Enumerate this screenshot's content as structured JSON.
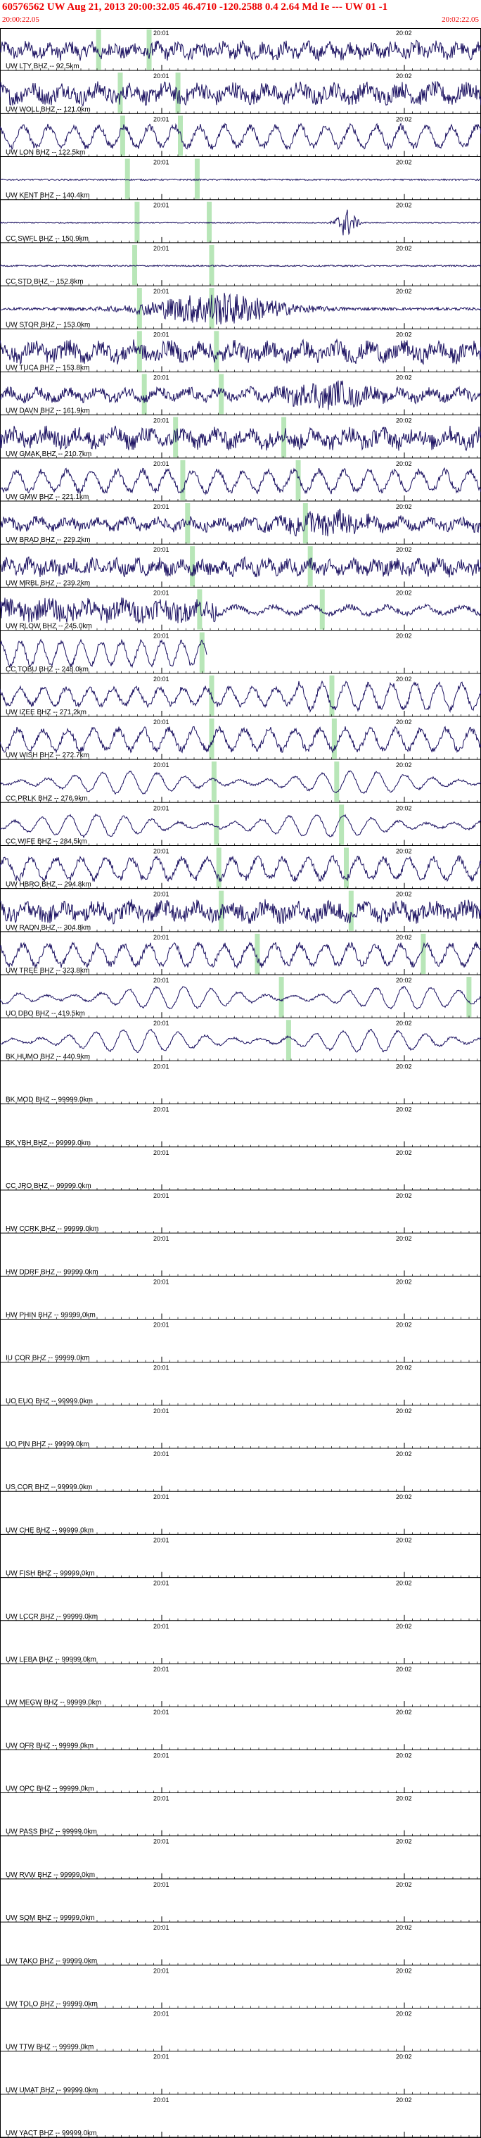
{
  "header": {
    "title": "60576562 UW Aug 21, 2013 20:00:32.05   46.4710 -120.2588  0.4 2.64 Md Ie --- UW 01   -1",
    "time_start": "20:00:22.05",
    "time_end": "20:02:22.05"
  },
  "minute_labels": [
    "20:01",
    "20:02"
  ],
  "colors": {
    "trace": "#1a1060",
    "axis": "#000000",
    "pick": "#b8e6b8",
    "header_text": "#ee0000"
  },
  "traces": [
    {
      "label": "UW LTY BHZ -- 92.5km",
      "waveform": "noisy-high",
      "picks": [
        0.205,
        0.31
      ]
    },
    {
      "label": "UW WOLL BHZ -- 121.0km",
      "waveform": "noisy-dense",
      "picks": [
        0.25,
        0.37
      ]
    },
    {
      "label": "UW LON BHZ -- 122.5km",
      "waveform": "oscillating",
      "picks": [
        0.255,
        0.375
      ]
    },
    {
      "label": "UW KENT BHZ -- 140.4km",
      "waveform": "flat",
      "picks": [
        0.265,
        0.41
      ]
    },
    {
      "label": "CC SWFL BHZ -- 150.9km",
      "waveform": "quiet-burst-right",
      "picks": [
        0.285,
        0.435
      ]
    },
    {
      "label": "CC STD BHZ -- 152.8km",
      "waveform": "flat",
      "picks": [
        0.28,
        0.44
      ]
    },
    {
      "label": "UW STOR BHZ -- 153.0km",
      "waveform": "big-burst",
      "picks": [
        0.29,
        0.44
      ]
    },
    {
      "label": "UW TUCA BHZ -- 153.8km",
      "waveform": "noisy-dense",
      "picks": [
        0.29,
        0.45
      ]
    },
    {
      "label": "UW DAVN BHZ -- 161.9km",
      "waveform": "noisy-burst-right",
      "picks": [
        0.3,
        0.46
      ]
    },
    {
      "label": "UW GMAK BHZ -- 210.7km",
      "waveform": "noisy-dense",
      "picks": [
        0.365,
        0.59
      ]
    },
    {
      "label": "UW GMW BHZ -- 221.1km",
      "waveform": "oscillating",
      "picks": [
        0.38,
        0.62
      ]
    },
    {
      "label": "UW BRAD BHZ -- 229.2km",
      "waveform": "noisy-burst-right",
      "picks": [
        0.39,
        0.635
      ]
    },
    {
      "label": "UW MRBL BHZ -- 239.2km",
      "waveform": "noisy-high",
      "picks": [
        0.4,
        0.645
      ]
    },
    {
      "label": "UW RLOW BHZ -- 245.0km",
      "waveform": "big-noisy-left",
      "picks": [
        0.415,
        0.67
      ]
    },
    {
      "label": "CC TOBU BHZ -- 248.0km",
      "waveform": "partial-left",
      "picks": [
        0.42
      ]
    },
    {
      "label": "UW IZEE BHZ -- 271.2km",
      "waveform": "oscillating-burst-right",
      "picks": [
        0.44,
        0.69
      ]
    },
    {
      "label": "UW WISH BHZ -- 272.7km",
      "waveform": "oscillating",
      "picks": [
        0.44,
        0.695
      ]
    },
    {
      "label": "CC PRLK BHZ -- 276.9km",
      "waveform": "oscillating-smooth",
      "picks": [
        0.445,
        0.7
      ]
    },
    {
      "label": "CC WIFE BHZ -- 284.5km",
      "waveform": "oscillating-smooth",
      "picks": [
        0.45,
        0.71
      ]
    },
    {
      "label": "UW HBRO BHZ -- 294.8km",
      "waveform": "oscillating",
      "picks": [
        0.455,
        0.72
      ]
    },
    {
      "label": "UW RADN BHZ -- 304.8km",
      "waveform": "noisy-dense",
      "picks": [
        0.46,
        0.73
      ]
    },
    {
      "label": "UW TREE BHZ -- 323.8km",
      "waveform": "oscillating",
      "picks": [
        0.535,
        0.88
      ]
    },
    {
      "label": "UO DBO BHZ -- 419.5km",
      "waveform": "oscillating-smooth",
      "picks": [
        0.585,
        0.975
      ]
    },
    {
      "label": "BK HUMO BHZ -- 440.9km",
      "waveform": "oscillating-smooth",
      "picks": [
        0.6
      ]
    },
    {
      "label": "BK MOD BHZ -- 99999.0km",
      "waveform": "none",
      "picks": []
    },
    {
      "label": "BK YBH BHZ -- 99999.0km",
      "waveform": "none",
      "picks": []
    },
    {
      "label": "CC JRO BHZ -- 99999.0km",
      "waveform": "none",
      "picks": []
    },
    {
      "label": "HW CCRK BHZ -- 99999.0km",
      "waveform": "none",
      "picks": []
    },
    {
      "label": "HW DDRF BHZ -- 99999.0km",
      "waveform": "none",
      "picks": []
    },
    {
      "label": "HW PHIN BHZ -- 99999.0km",
      "waveform": "none",
      "picks": []
    },
    {
      "label": "IU COR BHZ -- 99999.0km",
      "waveform": "none",
      "picks": []
    },
    {
      "label": "UO EUO BHZ -- 99999.0km",
      "waveform": "none",
      "picks": []
    },
    {
      "label": "UO PIN BHZ -- 99999.0km",
      "waveform": "none",
      "picks": []
    },
    {
      "label": "US COR BHZ -- 99999.0km",
      "waveform": "none",
      "picks": []
    },
    {
      "label": "UW CHE BHZ -- 99999.0km",
      "waveform": "none",
      "picks": []
    },
    {
      "label": "UW FISH BHZ -- 99999.0km",
      "waveform": "none",
      "picks": []
    },
    {
      "label": "UW LCCR BHZ -- 99999.0km",
      "waveform": "none",
      "picks": []
    },
    {
      "label": "UW LEBA BHZ -- 99999.0km",
      "waveform": "none",
      "picks": []
    },
    {
      "label": "UW MEGW BHZ -- 99999.0km",
      "waveform": "none",
      "picks": []
    },
    {
      "label": "UW OFR BHZ -- 99999.0km",
      "waveform": "none",
      "picks": []
    },
    {
      "label": "UW OPC BHZ -- 99999.0km",
      "waveform": "none",
      "picks": []
    },
    {
      "label": "UW PASS BHZ -- 99999.0km",
      "waveform": "none",
      "picks": []
    },
    {
      "label": "UW RVW BHZ -- 99999.0km",
      "waveform": "none",
      "picks": []
    },
    {
      "label": "UW SQM BHZ -- 99999.0km",
      "waveform": "none",
      "picks": []
    },
    {
      "label": "UW TAKO BHZ -- 99999.0km",
      "waveform": "none",
      "picks": []
    },
    {
      "label": "UW TOLO BHZ -- 99999.0km",
      "waveform": "none",
      "picks": []
    },
    {
      "label": "UW TTW BHZ -- 99999.0km",
      "waveform": "none",
      "picks": []
    },
    {
      "label": "UW UMAT BHZ -- 99999.0km",
      "waveform": "none",
      "picks": []
    },
    {
      "label": "UW YACT BHZ -- 99999.0km",
      "waveform": "none",
      "picks": []
    }
  ]
}
